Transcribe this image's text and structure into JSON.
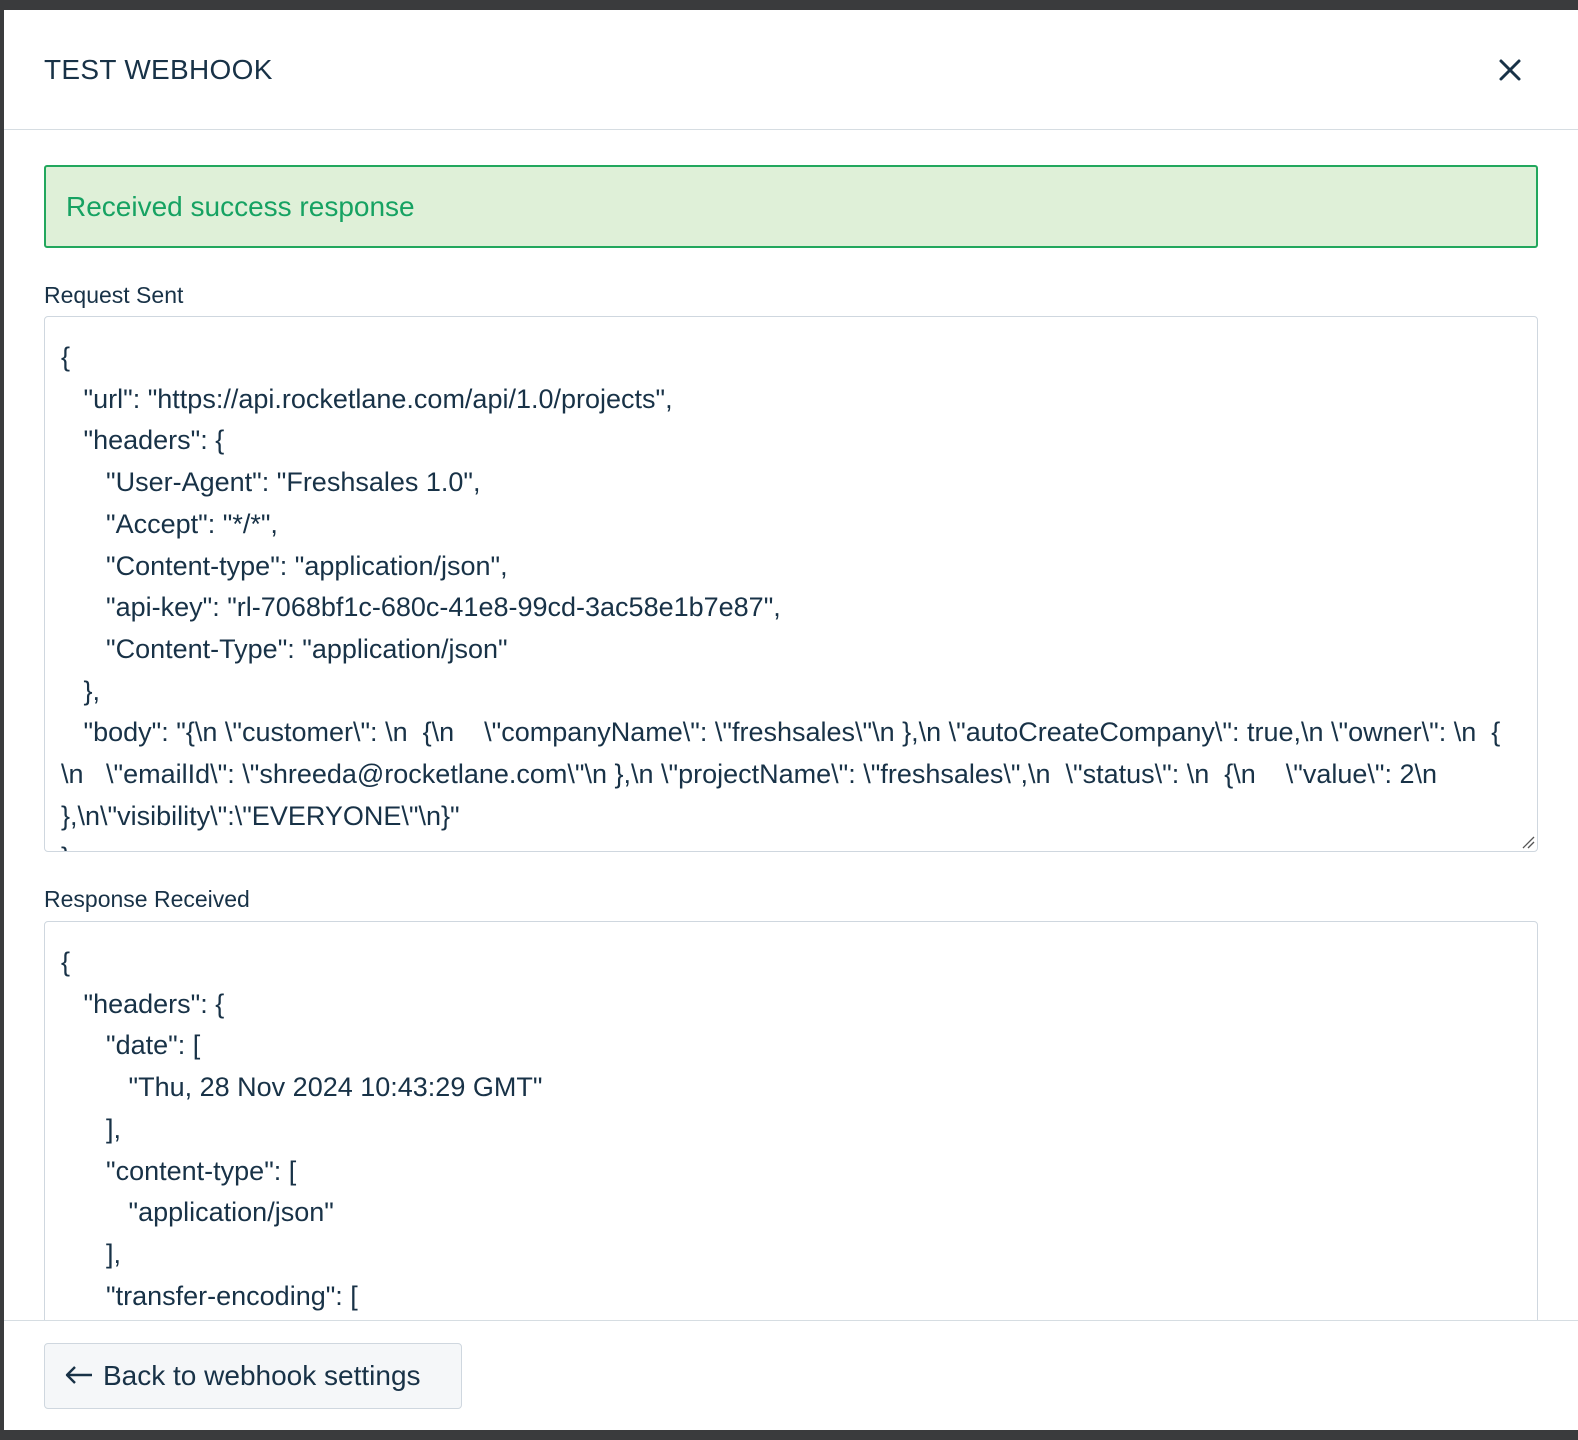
{
  "modal": {
    "title": "TEST WEBHOOK",
    "close_icon": "close-icon"
  },
  "alert": {
    "message": "Received success response",
    "color": "#16a262",
    "background": "#dff0d8"
  },
  "request": {
    "label": "Request Sent",
    "body": "{\n   \"url\": \"https://api.rocketlane.com/api/1.0/projects\",\n   \"headers\": {\n      \"User-Agent\": \"Freshsales 1.0\",\n      \"Accept\": \"*/*\",\n      \"Content-type\": \"application/json\",\n      \"api-key\": \"rl-7068bf1c-680c-41e8-99cd-3ac58e1b7e87\",\n      \"Content-Type\": \"application/json\"\n   },\n   \"body\": \"{\\n \\\"customer\\\": \\n  {\\n    \\\"companyName\\\": \\\"freshsales\\\"\\n },\\n \\\"autoCreateCompany\\\": true,\\n \\\"owner\\\": \\n  { \\n   \\\"emailId\\\": \\\"shreeda@rocketlane.com\\\"\\n },\\n \\\"projectName\\\": \\\"freshsales\\\",\\n  \\\"status\\\": \\n  {\\n    \\\"value\\\": 2\\n  },\\n\\\"visibility\\\":\\\"EVERYONE\\\"\\n}\"\n}"
  },
  "response": {
    "label": "Response Received",
    "body": "{\n   \"headers\": {\n      \"date\": [\n         \"Thu, 28 Nov 2024 10:43:29 GMT\"\n      ],\n      \"content-type\": [\n         \"application/json\"\n      ],\n      \"transfer-encoding\": [\n         \"chunked\"\n      ]\n   }\n}"
  },
  "footer": {
    "back_label": "Back to webhook settings",
    "back_icon": "arrow-left-icon"
  }
}
